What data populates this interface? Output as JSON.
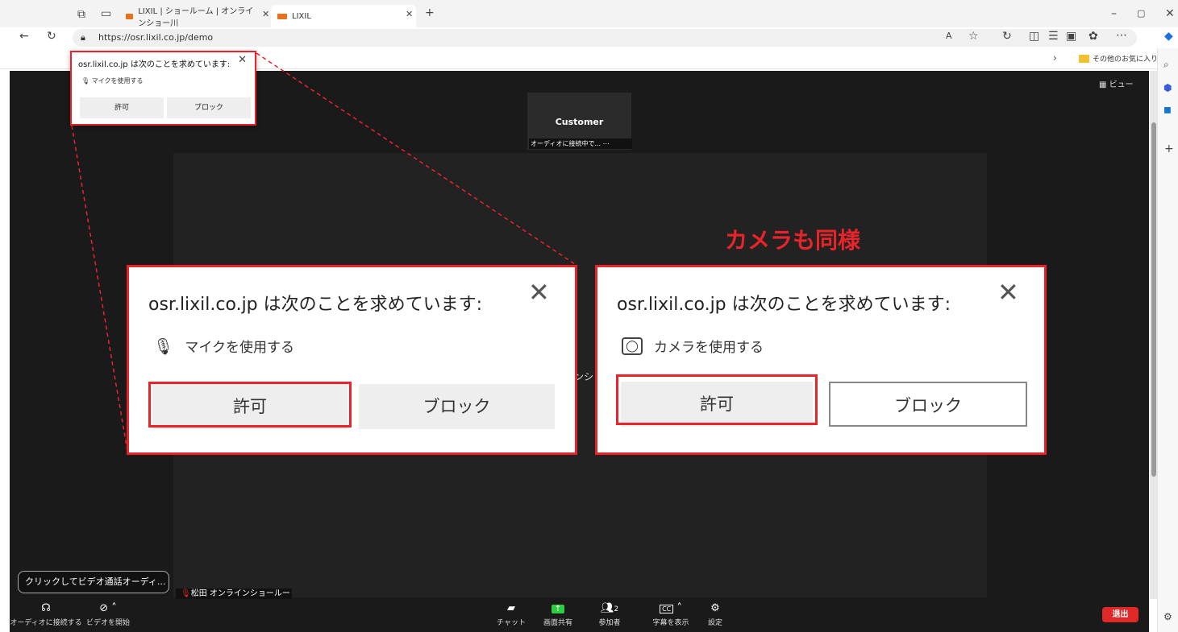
{
  "browser": {
    "tab1_label": "LIXIL | ショールーム | オンラインショー川",
    "tab2_label": "LIXIL",
    "url": "https://osr.lixil.co.jp/demo",
    "favorites_folder": "その他のお気に入り"
  },
  "meeting": {
    "customer_name": "Customer",
    "customer_status": "オーディオに接続中で... ⋯",
    "view_label": "ビュー",
    "name_tag": "松田 オンラインショールーム",
    "tooltip": "クリックしてビデオ通話オーディ...",
    "partial_text": "ンシ",
    "toolbar": {
      "audio_label": "オーディオに接続する",
      "video_label": "ビデオを開始",
      "chat_label": "チャット",
      "share_label": "画面共有",
      "participants_label": "参加者",
      "participants_count": "2",
      "captions_label": "字幕を表示",
      "settings_label": "設定",
      "leave_label": "退出"
    }
  },
  "mini_popup": {
    "title": "osr.lixil.co.jp は次のことを求めています:",
    "request": "マイクを使用する",
    "allow": "許可",
    "block": "ブロック"
  },
  "mic_popup": {
    "title": "osr.lixil.co.jp は次のことを求めています:",
    "request": "マイクを使用する",
    "allow": "許可",
    "block": "ブロック"
  },
  "camera_popup": {
    "title": "osr.lixil.co.jp は次のことを求めています:",
    "request": "カメラを使用する",
    "allow": "許可",
    "block": "ブロック"
  },
  "annotation": {
    "camera_same": "カメラも同様"
  },
  "colors": {
    "highlight": "#e8242a",
    "meeting_bg": "#1a1a1a",
    "leave": "#e02828",
    "share": "#2ecc40"
  }
}
